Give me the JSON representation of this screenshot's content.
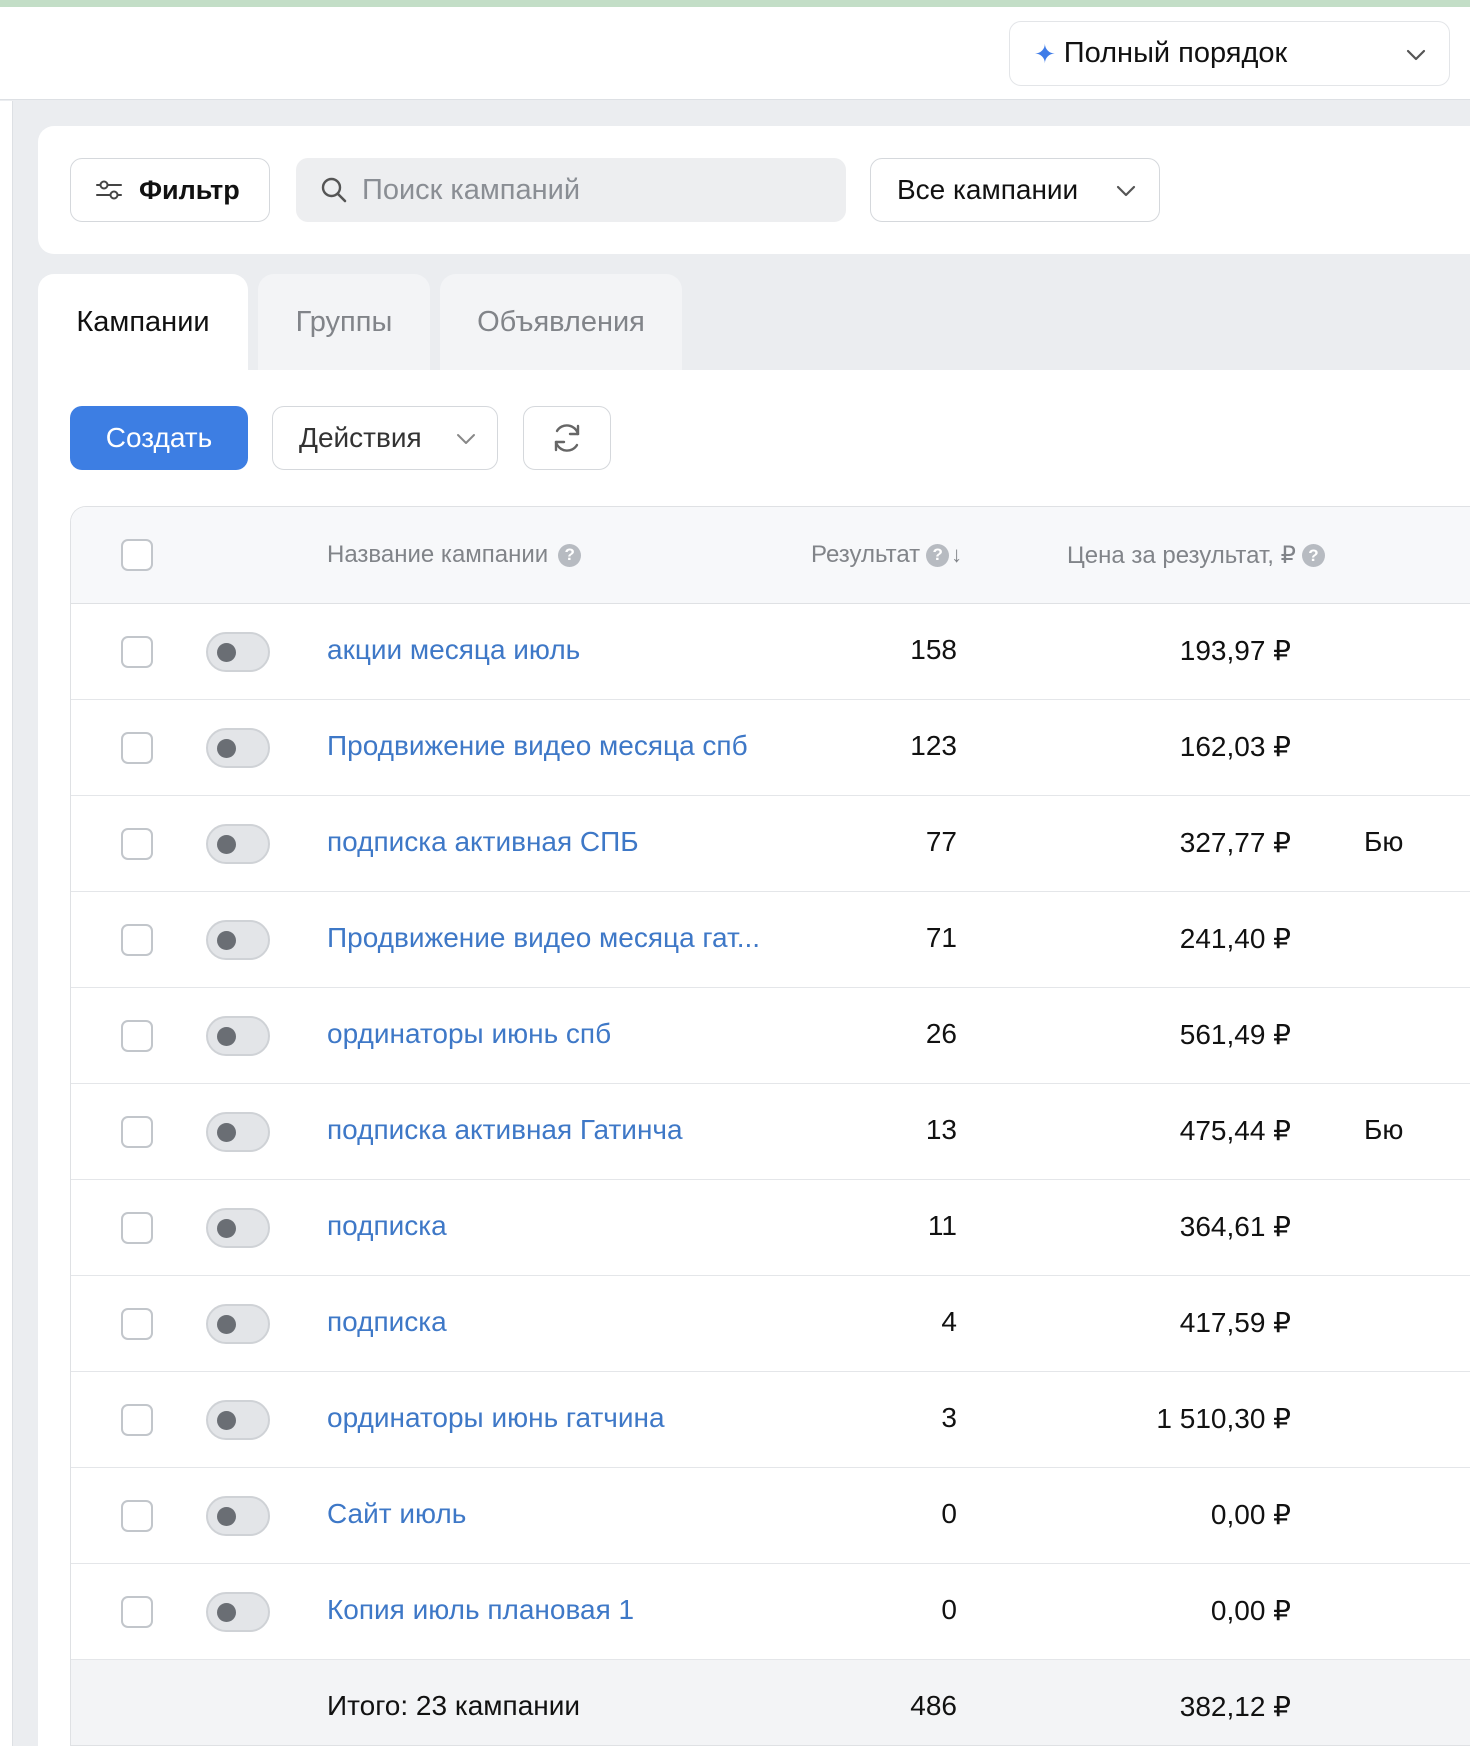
{
  "header": {
    "order_select_label": "Полный порядок"
  },
  "filters": {
    "filter_label": "Фильтр",
    "search_placeholder": "Поиск кампаний",
    "campaign_select_label": "Все кампании"
  },
  "tabs": [
    {
      "label": "Кампании",
      "active": true
    },
    {
      "label": "Группы",
      "active": false
    },
    {
      "label": "Объявления",
      "active": false
    }
  ],
  "toolbar": {
    "create_label": "Создать",
    "actions_label": "Действия"
  },
  "table": {
    "columns": {
      "name": "Название кампании",
      "result": "Результат",
      "sort_indicator": "↓",
      "price": "Цена за результат, ₽"
    },
    "rows": [
      {
        "name": "акции месяца июль",
        "result": "158",
        "price": "193,97 ₽",
        "extra": ""
      },
      {
        "name": "Продвижение видео месяца спб",
        "result": "123",
        "price": "162,03 ₽",
        "extra": ""
      },
      {
        "name": "подписка активная СПБ",
        "result": "77",
        "price": "327,77 ₽",
        "extra": "Бю"
      },
      {
        "name": "Продвижение видео месяца гат...",
        "result": "71",
        "price": "241,40 ₽",
        "extra": ""
      },
      {
        "name": "ординаторы июнь спб",
        "result": "26",
        "price": "561,49 ₽",
        "extra": ""
      },
      {
        "name": "подписка активная Гатинча",
        "result": "13",
        "price": "475,44 ₽",
        "extra": "Бю"
      },
      {
        "name": "подписка",
        "result": "11",
        "price": "364,61 ₽",
        "extra": ""
      },
      {
        "name": "подписка",
        "result": "4",
        "price": "417,59 ₽",
        "extra": ""
      },
      {
        "name": "ординаторы июнь гатчина",
        "result": "3",
        "price": "1 510,30 ₽",
        "extra": ""
      },
      {
        "name": "Сайт июль",
        "result": "0",
        "price": "0,00 ₽",
        "extra": ""
      },
      {
        "name": "Копия июль плановая 1",
        "result": "0",
        "price": "0,00 ₽",
        "extra": ""
      }
    ],
    "totals": {
      "label": "Итого: 23 кампании",
      "result": "486",
      "price": "382,12 ₽"
    }
  },
  "colors": {
    "accent": "#3d7ee3",
    "link": "#3e78c7",
    "top_strip": "#c3dec7"
  },
  "icons": {
    "order_select": "sparkle-icon",
    "filter": "sliders-icon",
    "search": "search-icon",
    "refresh": "refresh-icon",
    "dropdown": "chevron-down-icon",
    "help": "help-icon"
  }
}
